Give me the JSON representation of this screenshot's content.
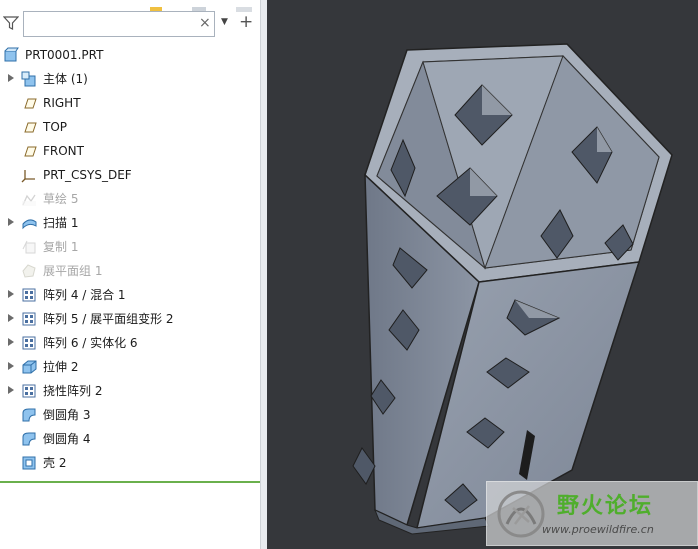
{
  "tree_panel": {
    "search": {
      "value": "",
      "placeholder": ""
    },
    "clear_symbol": "×",
    "add_symbol": "+",
    "dropdown_symbol": "▼",
    "items": [
      {
        "label": "PRT0001.PRT",
        "icon": "part-icon",
        "expandable": false,
        "suppressed": false
      },
      {
        "label": "主体 (1)",
        "icon": "body-icon",
        "expandable": true,
        "suppressed": false
      },
      {
        "label": "RIGHT",
        "icon": "datum-plane-icon",
        "expandable": false,
        "suppressed": false
      },
      {
        "label": "TOP",
        "icon": "datum-plane-icon",
        "expandable": false,
        "suppressed": false
      },
      {
        "label": "FRONT",
        "icon": "datum-plane-icon",
        "expandable": false,
        "suppressed": false
      },
      {
        "label": "PRT_CSYS_DEF",
        "icon": "coordinate-system-icon",
        "expandable": false,
        "suppressed": false
      },
      {
        "label": "草绘 5",
        "icon": "sketch-icon",
        "expandable": false,
        "suppressed": true
      },
      {
        "label": "扫描 1",
        "icon": "sweep-icon",
        "expandable": true,
        "suppressed": false
      },
      {
        "label": "复制 1",
        "icon": "copy-icon",
        "expandable": false,
        "suppressed": true
      },
      {
        "label": "展平面组 1",
        "icon": "flatten-quilt-icon",
        "expandable": false,
        "suppressed": true
      },
      {
        "label": "阵列 4 / 混合 1",
        "icon": "pattern-icon",
        "expandable": true,
        "suppressed": false
      },
      {
        "label": "阵列 5 / 展平面组变形 2",
        "icon": "pattern-icon",
        "expandable": true,
        "suppressed": false
      },
      {
        "label": "阵列 6 / 实体化 6",
        "icon": "pattern-icon",
        "expandable": true,
        "suppressed": false
      },
      {
        "label": "拉伸 2",
        "icon": "extrude-icon",
        "expandable": true,
        "suppressed": false
      },
      {
        "label": "挠性阵列 2",
        "icon": "pattern-icon",
        "expandable": true,
        "suppressed": false
      },
      {
        "label": "倒圆角 3",
        "icon": "round-icon",
        "expandable": false,
        "suppressed": false
      },
      {
        "label": "倒圆角 4",
        "icon": "round-icon",
        "expandable": false,
        "suppressed": false
      },
      {
        "label": "壳 2",
        "icon": "shell-icon",
        "expandable": false,
        "suppressed": false
      }
    ]
  },
  "viewport": {
    "background": "#35373b",
    "model_color": "#8a93a3",
    "watermark": {
      "title": "野火论坛",
      "url": "www.proewildfire.cn"
    }
  }
}
